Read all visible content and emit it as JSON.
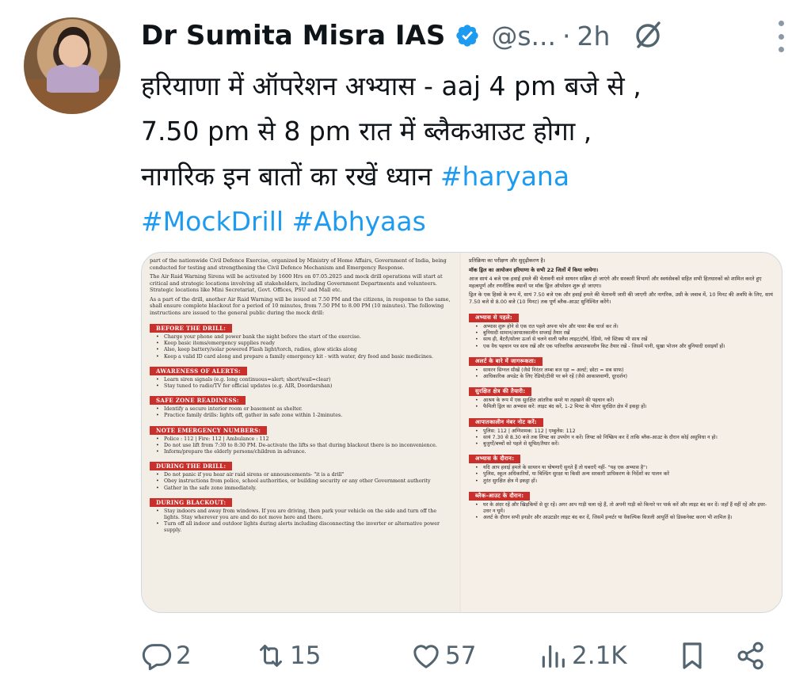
{
  "author": {
    "name": "Dr Sumita Misra IAS",
    "handle": "@s...",
    "time": "2h"
  },
  "tweet": {
    "line1": "हरियाणा में ऑपरेशन अभ्यास - aaj 4 pm बजे से ,",
    "line2": "7.50 pm से 8 pm रात में ब्लैकआउट होगा ,",
    "line3_text": "नागरिक इन बातों का रखें ध्यान ",
    "hashtag1": "#haryana",
    "hashtag2": "#MockDrill",
    "hashtag3": "#Abhyaas"
  },
  "media": {
    "left": {
      "intro1": "part of the nationwide Civil Defence Exercise, organized by Ministry of Home Affairs, Government of India, being conducted for testing and strengthening the Civil Defence Mechanism and Emergency Response.",
      "intro2": "The Air Raid Warning Sirens will be activated by 1600 Hrs on 07.05.2025 and mock drill operations will start at critical and strategic locations involving all stakeholders, including Government Departments and volunteers. Strategic locations like Mini Secretariat, Govt. Offices, PSU and Mall etc.",
      "intro3": "As a part of the drill, another Air Raid Warning will be issued at 7.50 PM and the citizens, in response to the same, shall ensure complete blackout for a period of 10 minutes, from 7.50 PM to 8.00 PM (10 minutes). The following instructions are issued to the general public during the mock drill:",
      "sections": [
        {
          "title": "BEFORE THE DRILL:",
          "items": [
            "Charge your phone and power bank the night before the start of the exercise.",
            "Keep basic items/emergency supplies ready",
            "Also, keep battery/solar powered Flash light/torch, radios, glow sticks along",
            "Keep a valid ID card along and prepare a family emergency kit - with water, dry food and basic medicines."
          ]
        },
        {
          "title": "AWARENESS OF ALERTS:",
          "items": [
            "Learn siren signals (e.g. long continuous=alert; short/wail=clear)",
            "Stay tuned to radio/TV for official updates (e.g. AIR, Doordarshan)"
          ]
        },
        {
          "title": "SAFE ZONE READINESS:",
          "items": [
            "Identify a secure interior room or basement as shelter.",
            "Practice family drills: lights off, gather in safe zone within 1-2minutes."
          ]
        },
        {
          "title": "NOTE EMERGENCY NUMBERS:",
          "items": [
            "Police : 112 | Fire: 112 | Ambulance : 112",
            "Do not use lift from 7:30 to 8:30 PM. De-activate the lifts so that during blackout there is no inconvenience.",
            "Inform/prepare the elderly persons/children in advance."
          ]
        },
        {
          "title": "DURING THE DRILL:",
          "items": [
            "Do not panic if you hear air raid sirens or announcements- \"it is a drill\"",
            "Obey instructions from police, school authorities, or building security or any other Government authority",
            "Gather in the safe zone immediately."
          ]
        },
        {
          "title": "DURING BLACKOUT:",
          "items": [
            "Stay indoors and away from windows. If you are driving, then park your vehicle on the side and turn off the lights. Stay wherever you are and do not move here and there.",
            "Turn off all indoor and outdoor lights during alerts including disconnecting the inverter or alternative power supply."
          ]
        }
      ]
    },
    "right": {
      "intro1": "प्रतिक्रिया का परीक्षण और सुदृढ़ीकरण है।",
      "intro2": "मॉक ड्रिल का आयोजन हरियाणा के सभी 22 जिलों में किया जायेगा।",
      "intro3": "आज सायं 4 बजे एक हवाई हमले की चेतावनी वाले सायरन सक्रिय हो जाएंगे और सरकारी विभागों और स्वयंसेवकों सहित सभी हितधारकों को शामिल करते हुए महत्वपूर्ण और रणनीतिक स्थानों पर मॉक ड्रिल ऑपरेशन शुरू हो जाएगा।",
      "intro4": "ड्रिल के एक हिस्से के रूप में, सायं 7.50 बजे एक और हवाई हमले की चेतावनी जारी की जाएगी और नागरिक, उसी के जवाब में, 10 मिनट की अवधि के लिए, सायं 7.50 बजे से 8.00 बजे (10 मिनट) तक पूर्ण ब्लैक-आउट सुनिश्चित करेंगे।",
      "sections": [
        {
          "title": "अभ्यास से पहले:",
          "items": [
            "अभ्यास शुरू होने से एक रात पहले अपना फोन और पावर बैंक चार्ज कर लें।",
            "बुनियादी सामान/आपातकालीन सप्लाई तैयार रखें",
            "साथ ही, बैटरी/सोलर ऊर्जा से चलने वाली फ्लैश लाइट/टॉर्च, रेडियो, ग्लो स्टिक्स भी साथ रखें",
            "एक वैध पहचान पत्र साथ रखें और एक पारिवारिक आपातकालीन किट तैयार रखें - जिसमें पानी, सूखा भोजन और बुनियादी दवाइयाँ हों।"
          ]
        },
        {
          "title": "अलर्ट के बारे में जागरूकता:",
          "items": [
            "सायरन सिग्नल सीखें (जैसे निरंतर लम्बा बज रहा = अलर्ट; छोटा = सब साफ)",
            "आधिकारिक अपडेट के लिए रेडियो/टीवी पर बने रहें (जैसे आकाशवाणी, दूरदर्शन)"
          ]
        },
        {
          "title": "सुरक्षित क्षेत्र की तैयारी:",
          "items": [
            "आश्रय के रूप में एक सुरक्षित आंतरिक कमरे या तहखाने की पहचान करें।",
            "फैमिली ड्रिल का अभ्यास करें: लाइट बंद करें, 1-2 मिनट के भीतर सुरक्षित क्षेत्र में इकट्ठा हों।"
          ]
        },
        {
          "title": "आपातकालीन नंबर नोट करें:",
          "items": [
            "पुलिस: 112 | अग्निशमक: 112 | एम्बुलेंस: 112",
            "सायं 7.30 से 8.30 बजे तक लिफ्ट का उपयोग न करें। लिफ्ट को निष्क्रिय कर दें ताकि ब्लैक-आउट के दौरान कोई असुविधा न हो।",
            "बुजुर्गों/बच्चों को पहले से सूचित/तैयार करें।"
          ]
        },
        {
          "title": "अभ्यास के दौरान:",
          "items": [
            "यदि आप हवाई हमले के सायरन या घोषणाएँ सुनते हैं तो घबराएँ नहीं- \"यह एक अभ्यास है\"।",
            "पुलिस, स्कूल अधिकारियों, या बिल्डिंग सुरक्षा या किसी अन्य सरकारी प्राधिकरण के निर्देशों का पालन करें",
            "तुरंत सुरक्षित क्षेत्र में इकट्ठा हों।"
          ]
        },
        {
          "title": "ब्लैक-आउट के दौरान:",
          "items": [
            "घर के अंदर रहें और खिड़कियों से दूर रहें। अगर आप गाड़ी चला रहे हैं, तो अपनी गाड़ी को किनारे पर पार्क करें और लाइट बंद कर दें। जहाँ हैं वहीं रहें और इधर-उधर न घूमें।",
            "अलर्ट के दौरान सभी इनडोर और आउटडोर लाइट बंद कर दें, जिसमें इन्वर्टर या वैकल्पिक बिजली आपूर्ति को डिस्कनेक्ट करना भी शामिल है।"
          ]
        }
      ]
    }
  },
  "actions": {
    "replies": "2",
    "reposts": "15",
    "likes": "57",
    "views": "2.1K"
  },
  "colors": {
    "hashtag": "#1d9bf0",
    "verified": "#1d9bf0",
    "muted": "#536471",
    "doc_heading": "#c9302c"
  },
  "icons": [
    "verified-badge-icon",
    "grok-icon",
    "more-icon",
    "reply-icon",
    "repost-icon",
    "like-icon",
    "views-icon",
    "bookmark-icon",
    "share-icon"
  ]
}
